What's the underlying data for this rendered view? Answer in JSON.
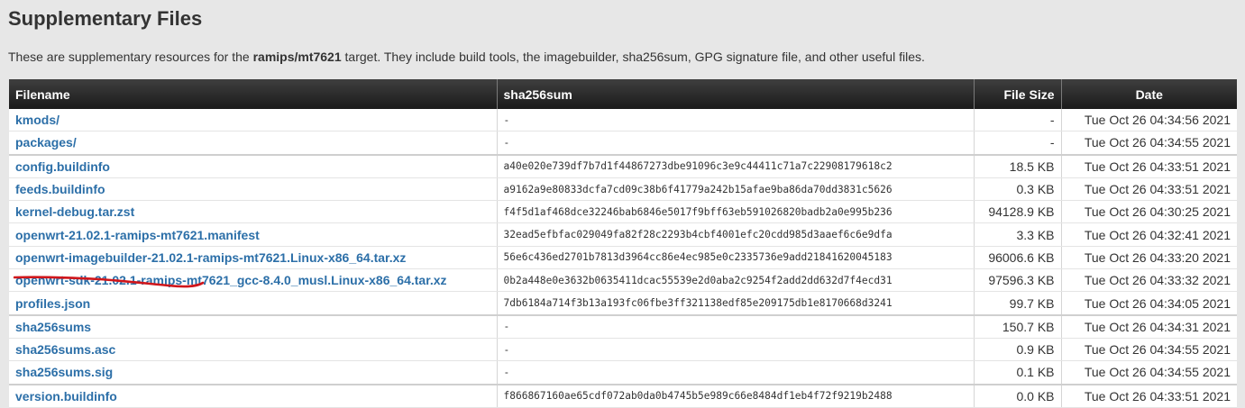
{
  "heading": "Supplementary Files",
  "intro": {
    "before": "These are supplementary resources for the ",
    "target": "ramips/mt7621",
    "after": " target. They include build tools, the imagebuilder, sha256sum, GPG signature file, and other useful files."
  },
  "table": {
    "headers": {
      "filename": "Filename",
      "sha256sum": "sha256sum",
      "size": "File Size",
      "date": "Date"
    },
    "rows": [
      {
        "name": "kmods/",
        "sha": "-",
        "size": "-",
        "date": "Tue Oct 26 04:34:56 2021"
      },
      {
        "name": "packages/",
        "sha": "-",
        "size": "-",
        "date": "Tue Oct 26 04:34:55 2021"
      },
      {
        "name": "config.buildinfo",
        "sha": "a40e020e739df7b7d1f44867273dbe91096c3e9c44411c71a7c22908179618c2",
        "size": "18.5 KB",
        "date": "Tue Oct 26 04:33:51 2021"
      },
      {
        "name": "feeds.buildinfo",
        "sha": "a9162a9e80833dcfa7cd09c38b6f41779a242b15afae9ba86da70dd3831c5626",
        "size": "0.3 KB",
        "date": "Tue Oct 26 04:33:51 2021"
      },
      {
        "name": "kernel-debug.tar.zst",
        "sha": "f4f5d1af468dce32246bab6846e5017f9bff63eb591026820badb2a0e995b236",
        "size": "94128.9 KB",
        "date": "Tue Oct 26 04:30:25 2021"
      },
      {
        "name": "openwrt-21.02.1-ramips-mt7621.manifest",
        "sha": "32ead5efbfac029049fa82f28c2293b4cbf4001efc20cdd985d3aaef6c6e9dfa",
        "size": "3.3 KB",
        "date": "Tue Oct 26 04:32:41 2021"
      },
      {
        "name": "openwrt-imagebuilder-21.02.1-ramips-mt7621.Linux-x86_64.tar.xz",
        "sha": "56e6c436ed2701b7813d3964cc86e4ec985e0c2335736e9add21841620045183",
        "size": "96006.6 KB",
        "date": "Tue Oct 26 04:33:20 2021"
      },
      {
        "name": "openwrt-sdk-21.02.1-ramips-mt7621_gcc-8.4.0_musl.Linux-x86_64.tar.xz",
        "sha": "0b2a448e0e3632b0635411dcac55539e2d0aba2c9254f2add2dd632d7f4ecd31",
        "size": "97596.3 KB",
        "date": "Tue Oct 26 04:33:32 2021"
      },
      {
        "name": "profiles.json",
        "sha": "7db6184a714f3b13a193fc06fbe3ff321138edf85e209175db1e8170668d3241",
        "size": "99.7 KB",
        "date": "Tue Oct 26 04:34:05 2021"
      },
      {
        "name": "sha256sums",
        "sha": "-",
        "size": "150.7 KB",
        "date": "Tue Oct 26 04:34:31 2021"
      },
      {
        "name": "sha256sums.asc",
        "sha": "-",
        "size": "0.9 KB",
        "date": "Tue Oct 26 04:34:55 2021"
      },
      {
        "name": "sha256sums.sig",
        "sha": "-",
        "size": "0.1 KB",
        "date": "Tue Oct 26 04:34:55 2021"
      },
      {
        "name": "version.buildinfo",
        "sha": "f866867160ae65cdf072ab0da0b4745b5e989c66e8484df1eb4f72f9219b2488",
        "size": "0.0 KB",
        "date": "Tue Oct 26 04:33:51 2021"
      }
    ]
  },
  "annotation": {
    "color": "#d0161b",
    "marked_file": "openwrt-sdk-21.02.1-ramips-mt7621_gcc-8.4.0_musl.Linux-x86_64.tar.xz"
  }
}
